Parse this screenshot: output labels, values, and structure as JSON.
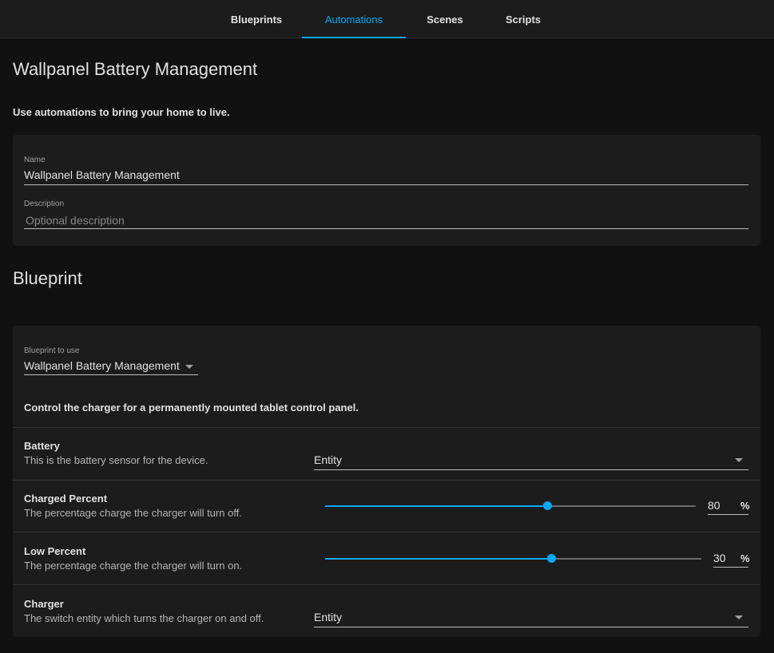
{
  "tabs": [
    {
      "label": "Blueprints",
      "active": false
    },
    {
      "label": "Automations",
      "active": true
    },
    {
      "label": "Scenes",
      "active": false
    },
    {
      "label": "Scripts",
      "active": false
    }
  ],
  "page": {
    "title": "Wallpanel Battery Management",
    "subtitle": "Use automations to bring your home to live."
  },
  "name_card": {
    "name_label": "Name",
    "name_value": "Wallpanel Battery Management",
    "description_label": "Description",
    "description_placeholder": "Optional description"
  },
  "blueprint": {
    "section_title": "Blueprint",
    "select_label": "Blueprint to use",
    "select_value": "Wallpanel Battery Management",
    "description": "Control the charger for a permanently mounted tablet control panel.",
    "inputs": [
      {
        "title": "Battery",
        "description": "This is the battery sensor for the device.",
        "type": "entity",
        "placeholder": "Entity"
      },
      {
        "title": "Charged Percent",
        "description": "The percentage charge the charger will turn off.",
        "type": "slider",
        "value": "80",
        "unit": "%",
        "fraction": 0.6
      },
      {
        "title": "Low Percent",
        "description": "The percentage charge the charger will turn on.",
        "type": "slider",
        "value": "30",
        "unit": "%",
        "fraction": 0.6
      },
      {
        "title": "Charger",
        "description": "The switch entity which turns the charger on and off.",
        "type": "entity",
        "placeholder": "Entity"
      }
    ]
  },
  "colors": {
    "accent": "#03a9f4",
    "background": "#111111",
    "card": "#1c1c1c"
  }
}
